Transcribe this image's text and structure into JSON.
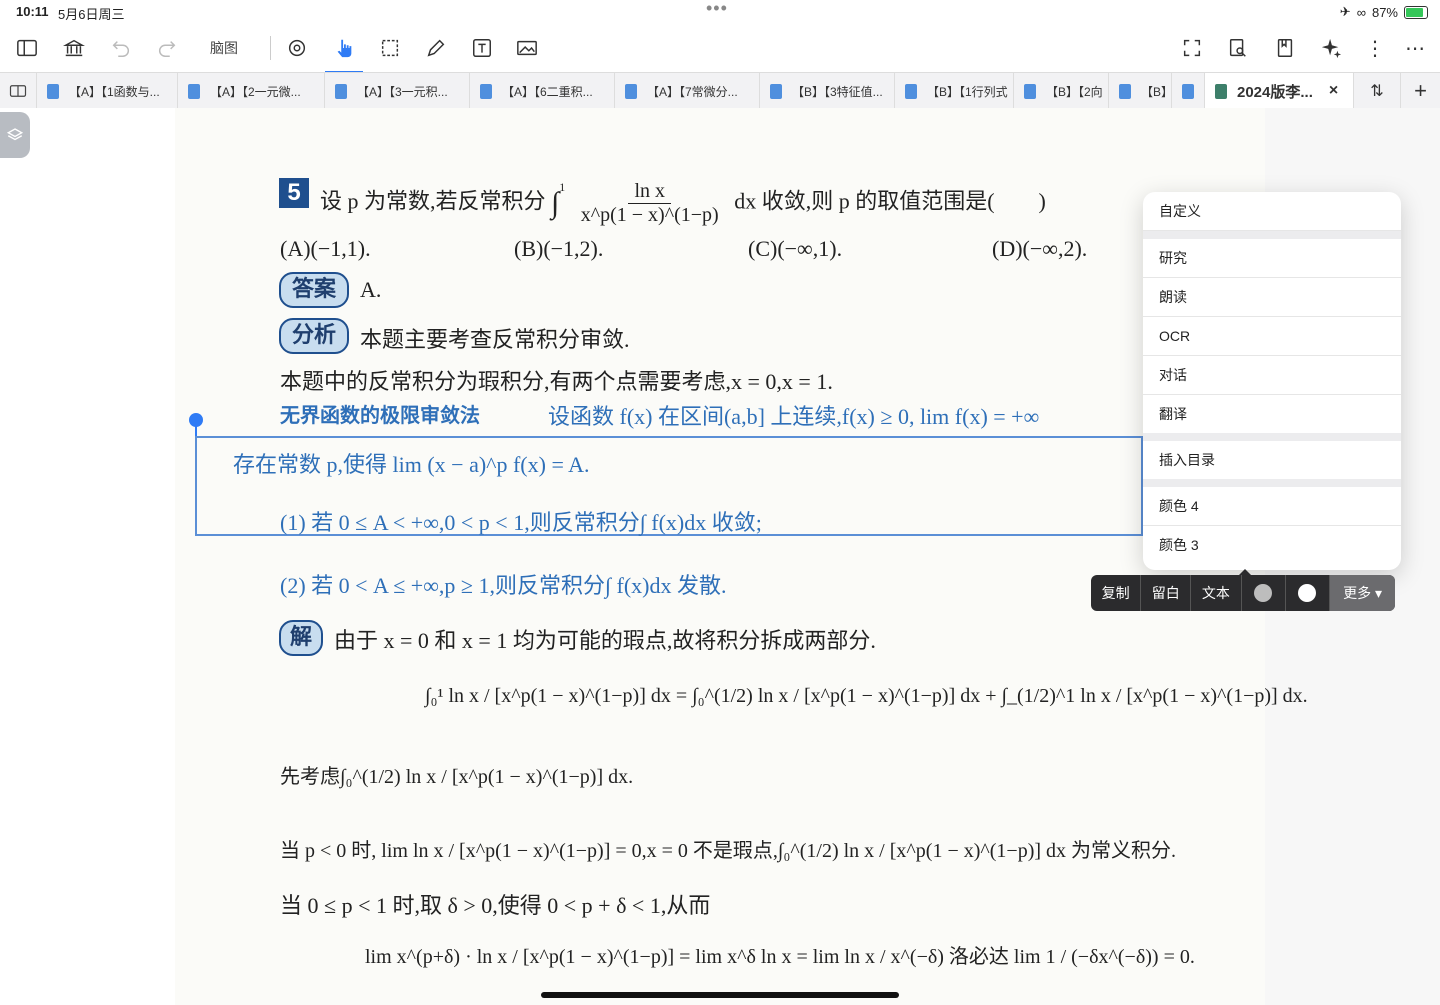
{
  "status": {
    "time": "10:11",
    "date": "5月6日周三",
    "battery": "87%"
  },
  "toolbar": {
    "mindmap_label": "脑图"
  },
  "tabs": [
    {
      "label": "【A】【1函数与..."
    },
    {
      "label": "【A】【2一元微..."
    },
    {
      "label": "【A】【3一元积..."
    },
    {
      "label": "【A】【6二重积..."
    },
    {
      "label": "【A】【7常微分..."
    },
    {
      "label": "【B】【3特征值..."
    },
    {
      "label": "【B】【1行列式"
    },
    {
      "label": "【B】【2向"
    },
    {
      "label": "【B】"
    },
    {
      "label": ""
    }
  ],
  "current_tab": {
    "label": "2024版李...",
    "close": "×"
  },
  "tab_actions": {
    "sort": "⇅",
    "add": "+"
  },
  "doc": {
    "q_num": "5",
    "question_text": "设 p 为常数,若反常积分",
    "integral_num": "ln x",
    "integral_den": "x^p(1 − x)^(1−p)",
    "question_tail": "dx 收敛,则 p 的取值范围是(　　)",
    "options": [
      "(A)(−1,1).",
      "(B)(−1,2).",
      "(C)(−∞,1).",
      "(D)(−∞,2)."
    ],
    "answer_badge": "答案",
    "answer": "A.",
    "analysis_badge": "分析",
    "analysis": "本题主要考查反常积分审敛.",
    "para1": "本题中的反常积分为瑕积分,有两个点需要考虑,x = 0,x = 1.",
    "theorem_title": "无界函数的极限审敛法",
    "theorem_text": "设函数 f(x) 在区间(a,b] 上连续,f(x) ≥ 0, lim f(x) = +∞",
    "theorem_line2": "存在常数 p,使得 lim (x − a)^p f(x) = A.",
    "theorem_case1": "(1) 若 0 ≤ A < +∞,0 < p < 1,则反常积分∫ f(x)dx 收敛;",
    "theorem_case2": "(2) 若 0 < A ≤ +∞,p ≥ 1,则反常积分∫ f(x)dx 发散.",
    "solution_badge": "解",
    "solution": "由于 x = 0 和 x = 1 均为可能的瑕点,故将积分拆成两部分.",
    "eq_split": "∫₀¹ ln x / [x^p(1 − x)^(1−p)] dx = ∫₀^(1/2) ln x / [x^p(1 − x)^(1−p)] dx + ∫_(1/2)^1 ln x / [x^p(1 − x)^(1−p)] dx.",
    "consider": "先考虑∫₀^(1/2) ln x / [x^p(1 − x)^(1−p)] dx.",
    "case_p_neg": "当 p < 0 时, lim ln x / [x^p(1 − x)^(1−p)] = 0,x = 0 不是瑕点,∫₀^(1/2) ln x / [x^p(1 − x)^(1−p)] dx 为常义积分.",
    "case_p_01": "当 0 ≤ p < 1 时,取 δ > 0,使得 0 < p + δ < 1,从而",
    "eq_last": "lim x^(p+δ) · ln x / [x^p(1 − x)^(1−p)] = lim x^δ ln x = lim ln x / x^(−δ) 洛必达 lim 1 / (−δx^(−δ)) = 0."
  },
  "context_menu": {
    "items_group1": [
      "自定义"
    ],
    "items_group2": [
      "研究",
      "朗读",
      "OCR",
      "对话",
      "翻译"
    ],
    "items_group3": [
      "插入目录"
    ],
    "items_group4": [
      "颜色 4",
      "颜色 3"
    ]
  },
  "popup": {
    "copy": "复制",
    "blank": "留白",
    "text": "文本",
    "more": "更多 ▾"
  },
  "colors": {
    "accent": "#2f7bf5",
    "doc_blue": "#2e6fb8",
    "popup_bg": "#2b2b2d"
  }
}
